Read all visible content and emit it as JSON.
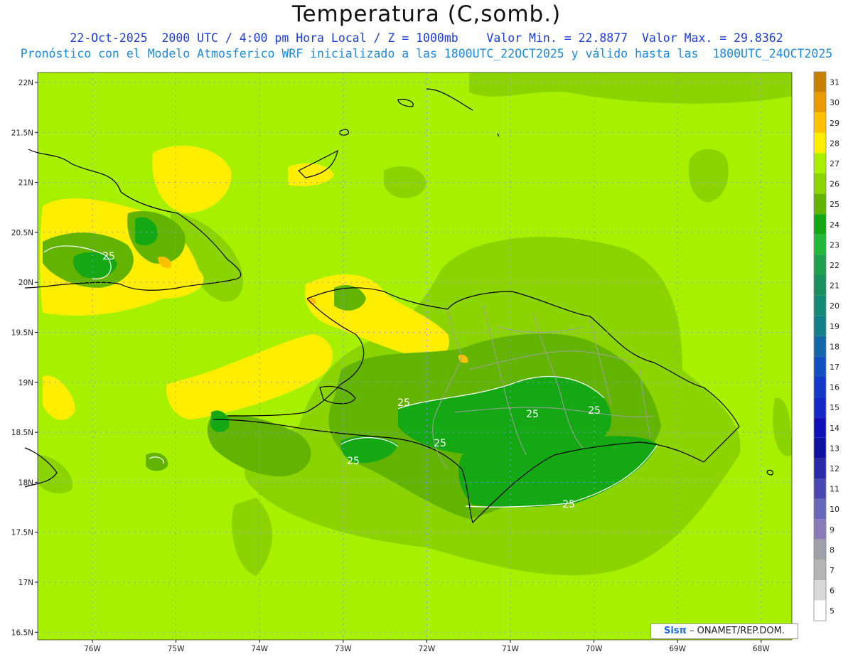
{
  "header": {
    "title": "Temperatura (C,somb.)",
    "line1": "22-Oct-2025  2000 UTC / 4:00 pm Hora Local / Z = 1000mb    Valor Min. = 22.8877  Valor Max. = 29.8362",
    "line2": "Pronóstico con el Modelo Atmosferico WRF inicializado a las 1800UTC_22OCT2025 y válido hasta las  1800UTC_24OCT2025"
  },
  "axes": {
    "lat_labels": [
      "22N",
      "21.5N",
      "21N",
      "20.5N",
      "20N",
      "19.5N",
      "19N",
      "18.5N",
      "18N",
      "17.5N",
      "17N",
      "16.5N"
    ],
    "lon_labels": [
      "76W",
      "75W",
      "74W",
      "73W",
      "72W",
      "71W",
      "70W",
      "69W",
      "68W"
    ]
  },
  "contour_labels": [
    "25",
    "25",
    "25",
    "25",
    "25",
    "25",
    "25"
  ],
  "colorbar": {
    "labels": [
      "31",
      "30",
      "29",
      "28",
      "27",
      "26",
      "25",
      "24",
      "23",
      "22",
      "21",
      "20",
      "19",
      "18",
      "17",
      "16",
      "15",
      "14",
      "13",
      "12",
      "11",
      "10",
      "9",
      "8",
      "7",
      "6",
      "5"
    ],
    "colors": [
      "#c88000",
      "#e89a00",
      "#ffc000",
      "#ffee00",
      "#a6f000",
      "#8cd400",
      "#62b400",
      "#14a814",
      "#22b83c",
      "#1ea050",
      "#1a8f60",
      "#158a78",
      "#137f88",
      "#1368a8",
      "#1350c0",
      "#1438c8",
      "#1428c8",
      "#1010b8",
      "#1010a0",
      "#2a2aa8",
      "#4848b0",
      "#6868b8",
      "#8a7ab8",
      "#a0a0a8",
      "#b4b4b4",
      "#d8d8d8",
      "#ffffff"
    ]
  },
  "colors": {
    "background_field": "#a6f000",
    "warm": "#ffee00",
    "mid": "#8cd400",
    "cool": "#62b400",
    "coolest": "#14a814",
    "orange": "#ffc000",
    "grid_dots": "#8f8fff",
    "title_blue": "#1a3ce0",
    "subtitle_blue": "#1a8ae0"
  },
  "credit": {
    "logo": "Sisπ",
    "text": "– ONAMET/REP.DOM."
  }
}
